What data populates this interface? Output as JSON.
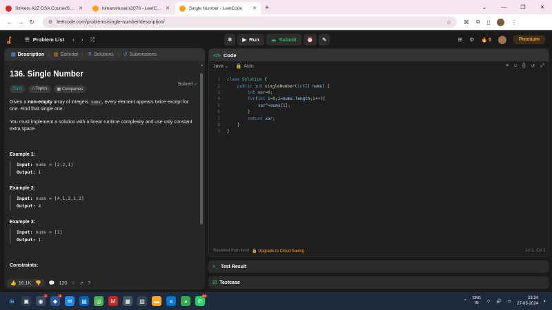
{
  "browser": {
    "tabs": [
      {
        "title": "Strivers A2Z DSA Course/Sheet",
        "color": "#d62c2c",
        "active": false
      },
      {
        "title": "himanshusaini2076 - LeetCode",
        "color": "#ffa116",
        "active": false
      },
      {
        "title": "Single Number - LeetCode",
        "color": "#ffa116",
        "active": true
      }
    ],
    "new_tab": "+",
    "url": "leetcode.com/problems/single-number/description/"
  },
  "header": {
    "problem_list": "Problem List",
    "run": "Run",
    "submit": "Submit",
    "streak": "5",
    "premium": "Premium"
  },
  "left": {
    "tabs": [
      "Description",
      "Editorial",
      "Solutions",
      "Submissions"
    ],
    "title": "136. Single Number",
    "status": "Solved",
    "chips": [
      "Easy",
      "Topics",
      "Companies"
    ],
    "desc1_a": "Given a ",
    "desc1_b": "non-empty",
    "desc1_c": " array of integers ",
    "desc1_code": "nums",
    "desc1_d": ", every element appears twice except for one. Find that single one.",
    "desc2": "You must implement a solution with a linear runtime complexity and use only constant extra space.",
    "examples": [
      {
        "heading": "Example 1:",
        "input_label": "Input:",
        "input": "nums = [2,2,1]",
        "output_label": "Output:",
        "output": "1"
      },
      {
        "heading": "Example 2:",
        "input_label": "Input:",
        "input": "nums = [4,1,2,1,2]",
        "output_label": "Output:",
        "output": "4"
      },
      {
        "heading": "Example 3:",
        "input_label": "Input:",
        "input": "nums = [1]",
        "output_label": "Output:",
        "output": "1"
      }
    ],
    "constraints": "Constraints:",
    "likes": "16.1K",
    "comments": "120"
  },
  "code": {
    "title": "Code",
    "language": "Java",
    "mode": "Auto",
    "footer_left": "Restored from local",
    "footer_upgrade": "Upgrade to Cloud Saving",
    "cursor": "Ln 1, Col 1"
  },
  "panels": {
    "test_result": "Test Result",
    "testcase": "Testcase"
  },
  "taskbar": {
    "lang_top": "ENG",
    "lang_bottom": "IN",
    "time": "23:34",
    "date": "27-03-2024",
    "badges": {
      "b1": "1",
      "b2": "1",
      "b3": "14"
    }
  }
}
